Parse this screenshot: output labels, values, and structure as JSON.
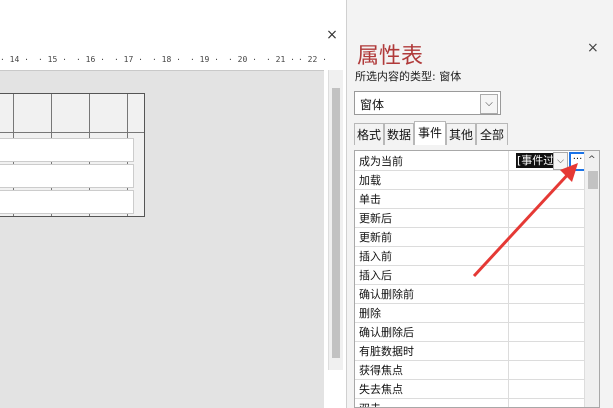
{
  "design_view": {
    "close_glyph": "×",
    "ruler_marks": [
      "· 14 ·",
      "· 15 ·",
      "· 16 ·",
      "· 17 ·",
      "· 18 ·",
      "· 19 ·",
      "· 20 ·",
      "· 21 ·",
      "· 22 ·"
    ]
  },
  "property_sheet": {
    "title": "属性表",
    "close_glyph": "×",
    "selection_type_label": "所选内容的类型: 窗体",
    "selected_object": "窗体",
    "tabs": [
      {
        "label": "格式",
        "active": false
      },
      {
        "label": "数据",
        "active": false
      },
      {
        "label": "事件",
        "active": true
      },
      {
        "label": "其他",
        "active": false
      },
      {
        "label": "全部",
        "active": false
      }
    ],
    "rows": [
      {
        "name": "成为当前",
        "value": "[事件过"
      },
      {
        "name": "加载",
        "value": ""
      },
      {
        "name": "单击",
        "value": ""
      },
      {
        "name": "更新后",
        "value": ""
      },
      {
        "name": "更新前",
        "value": ""
      },
      {
        "name": "插入前",
        "value": ""
      },
      {
        "name": "插入后",
        "value": ""
      },
      {
        "name": "确认删除前",
        "value": ""
      },
      {
        "name": "删除",
        "value": ""
      },
      {
        "name": "确认删除后",
        "value": ""
      },
      {
        "name": "有脏数据时",
        "value": ""
      },
      {
        "name": "获得焦点",
        "value": ""
      },
      {
        "name": "失去焦点",
        "value": ""
      },
      {
        "name": "双击",
        "value": ""
      }
    ],
    "builder_button_label": "···",
    "dropdown_glyph": "⌵",
    "scroll_up_glyph": "^"
  },
  "annotation": {
    "color": "#e53935"
  }
}
